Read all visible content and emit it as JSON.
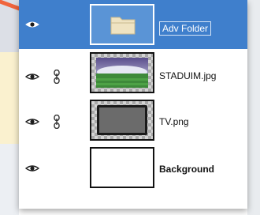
{
  "layers": [
    {
      "name": "Adv Folder",
      "kind": "folder",
      "selected": true,
      "visible": true,
      "linked": false,
      "thumbnail_icon": "folder-icon"
    },
    {
      "name": "STADUIM.jpg",
      "kind": "image",
      "selected": false,
      "visible": true,
      "linked": true,
      "thumbnail_icon": "stadium-thumbnail"
    },
    {
      "name": "TV.png",
      "kind": "image",
      "selected": false,
      "visible": true,
      "linked": true,
      "thumbnail_icon": "tv-thumbnail"
    },
    {
      "name": "Background",
      "kind": "background",
      "selected": false,
      "visible": true,
      "linked": false,
      "thumbnail_icon": "blank-white-thumbnail"
    }
  ],
  "colors": {
    "selected_row": "#3f7fcc",
    "accent_arrow": "#f0643c",
    "text": "#111111"
  }
}
